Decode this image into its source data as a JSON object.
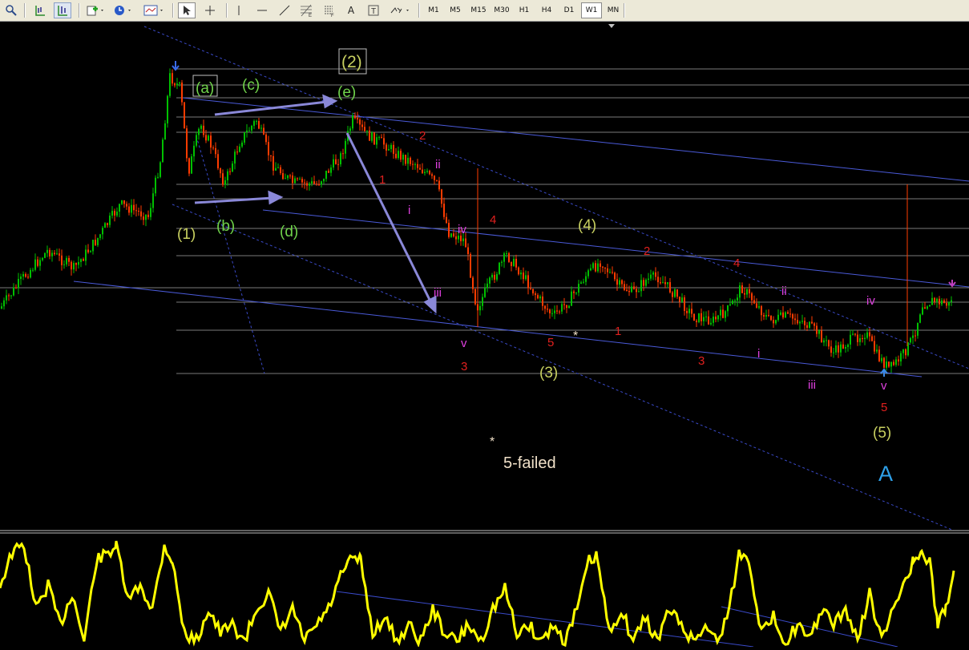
{
  "toolbar": {
    "timeframes": [
      "M1",
      "M5",
      "M15",
      "M30",
      "H1",
      "H4",
      "D1",
      "W1",
      "MN"
    ],
    "active_timeframe": "W1",
    "icons": [
      "zoom-icon",
      "line-chart-icon",
      "bar-chart-icon",
      "new-order-icon",
      "clock-icon",
      "template-icon",
      "cursor-icon",
      "crosshair-icon",
      "vertical-line-icon",
      "horizontal-line-icon",
      "trendline-icon",
      "fibonacci-icon",
      "text-fibo-icon",
      "text-icon",
      "label-icon",
      "arrows-icon"
    ],
    "text_tool": "A",
    "label_tool": "T"
  },
  "wave_labels": {
    "a": "(a)",
    "b": "(b)",
    "c": "(c)",
    "d": "(d)",
    "e": "(e)",
    "w1": "(1)",
    "w2": "(2)",
    "w3": "(3)",
    "w4": "(4)",
    "w5": "(5)",
    "big_a": "A",
    "failed": "5-failed",
    "star": "*",
    "r1a": "1",
    "r2a": "2",
    "r3a": "3",
    "r4a": "4",
    "r5a": "5",
    "r1b": "1",
    "r2b": "2",
    "r3b": "3",
    "r4b": "4",
    "r5b": "5",
    "m_i_a": "i",
    "m_ii_a": "ii",
    "m_iii_a": "iii",
    "m_iv_a": "iv",
    "m_v_a": "v",
    "m_i_b": "i",
    "m_ii_b": "ii",
    "m_iii_b": "iii",
    "m_iv_b": "iv",
    "m_v_b": "v"
  },
  "colors": {
    "bull": "#00c000",
    "bear": "#ff3c00",
    "green_label": "#6fd24a",
    "olive_label": "#c8d060",
    "red_label": "#e0201e",
    "magenta_label": "#e040e0",
    "trend_blue": "#4a5ad8",
    "arrow": "#8a88d8",
    "oscillator": "#ffff00",
    "big_a": "#2ea0e8",
    "failed": "#f0e0c8"
  },
  "chart_data": {
    "type": "candlestick",
    "title": "",
    "xlabel": "",
    "ylabel": "",
    "note": "Price chart with Elliott wave annotations and a yellow oscillator sub-window; no axis values visible."
  }
}
